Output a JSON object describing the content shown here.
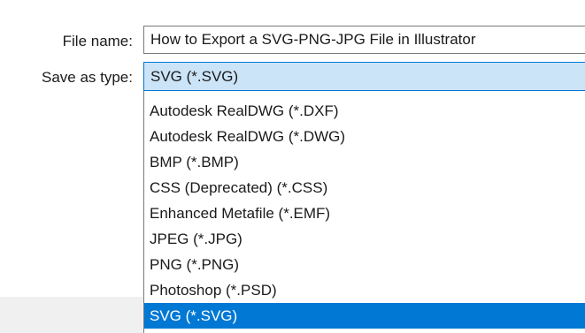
{
  "file_name": {
    "label": "File name:",
    "value": "How to Export a SVG-PNG-JPG File in Illustrator"
  },
  "save_as_type": {
    "label": "Save as type:",
    "selected": "SVG (*.SVG)",
    "options": [
      "Autodesk RealDWG (*.DXF)",
      "Autodesk RealDWG (*.DWG)",
      "BMP (*.BMP)",
      "CSS (Deprecated) (*.CSS)",
      "Enhanced Metafile (*.EMF)",
      "JPEG (*.JPG)",
      "PNG (*.PNG)",
      "Photoshop (*.PSD)",
      "SVG (*.SVG)"
    ],
    "highlighted_index": 8
  },
  "colors": {
    "selection_blue": "#0078d4",
    "select_box_fill": "#cce4f7",
    "input_border": "#7a7a7a",
    "footer_band": "#f0f0f0"
  }
}
